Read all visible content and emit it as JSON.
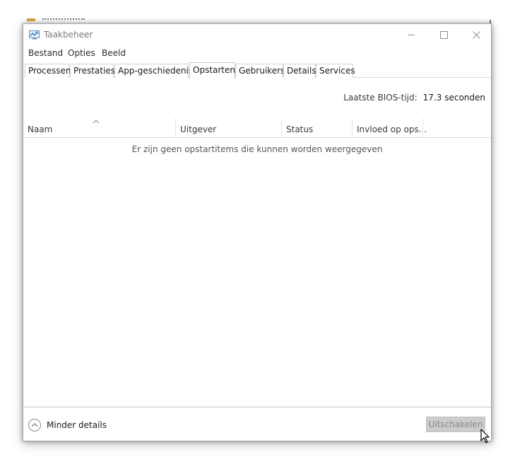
{
  "window": {
    "title": "Taakbeheer"
  },
  "menu": [
    {
      "label": "Bestand"
    },
    {
      "label": "Opties"
    },
    {
      "label": "Beeld"
    }
  ],
  "tabs": [
    {
      "label": "Processen",
      "active": false
    },
    {
      "label": "Prestaties",
      "active": false
    },
    {
      "label": "App-geschiedenis",
      "active": false
    },
    {
      "label": "Opstarten",
      "active": true
    },
    {
      "label": "Gebruikers",
      "active": false
    },
    {
      "label": "Details",
      "active": false
    },
    {
      "label": "Services",
      "active": false
    }
  ],
  "bios": {
    "label": "Laatste BIOS-tijd:",
    "value": "17.3 seconden"
  },
  "columns": [
    {
      "label": "Naam"
    },
    {
      "label": "Uitgever"
    },
    {
      "label": "Status"
    },
    {
      "label": "Invloed op ops..."
    }
  ],
  "empty_message": "Er zijn geen opstartitems die kunnen worden weergegeven",
  "footer": {
    "less_details_label": "Minder details",
    "disable_label": "Uitschakelen"
  },
  "icons": {
    "app": "task-manager-icon",
    "minimize": "minimize-icon",
    "maximize": "maximize-icon",
    "close": "close-icon",
    "sort": "sort-ascending-icon",
    "collapse": "chevron-up-circle-icon",
    "cursor": "mouse-pointer-icon"
  },
  "colors": {
    "disabled_button_bg": "#cccccc",
    "disabled_button_text": "#8a8a8a",
    "title_text": "#7a7a7a"
  }
}
